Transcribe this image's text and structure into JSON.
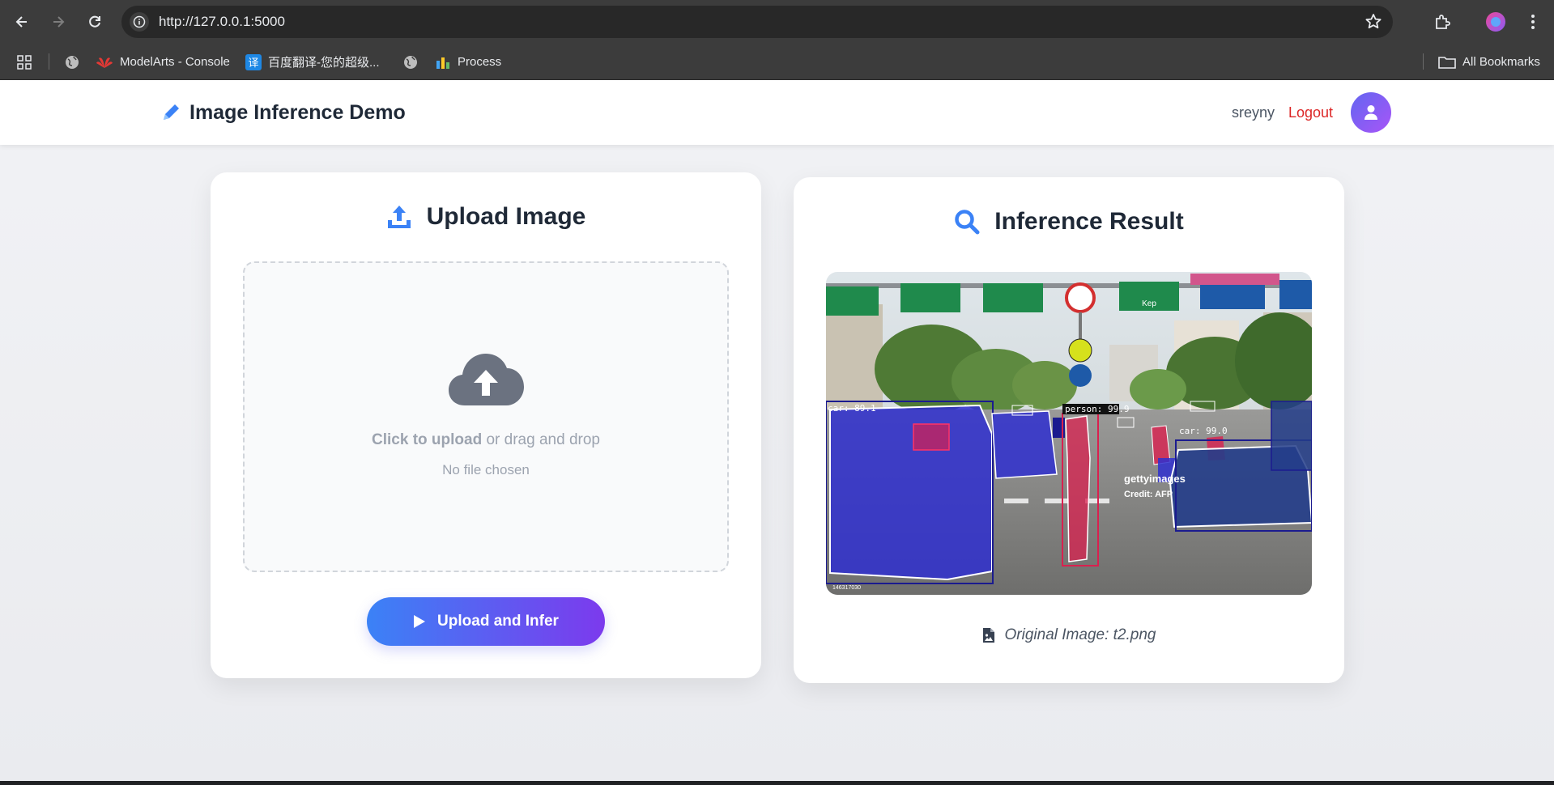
{
  "browser": {
    "url": "http://127.0.0.1:5000",
    "bookmarks": [
      {
        "label": "ModelArts - Console",
        "icon": "huawei-icon"
      },
      {
        "label": "百度翻译-您的超级...",
        "icon": "translate-icon"
      },
      {
        "label": "Process",
        "icon": "process-icon"
      }
    ],
    "all_bookmarks_label": "All Bookmarks"
  },
  "header": {
    "title": "Image Inference Demo",
    "username": "sreyny",
    "logout_label": "Logout",
    "accent_color": "#3b82f6"
  },
  "upload": {
    "title": "Upload Image",
    "click_text": "Click to upload",
    "drag_text": " or drag and drop",
    "file_status": "No file chosen",
    "button_label": "Upload and Infer"
  },
  "result": {
    "title": "Inference Result",
    "caption": "Original Image: t2.png",
    "detections": [
      {
        "label": "car: 89.1"
      },
      {
        "label": "person: 99.9"
      },
      {
        "label": "car: 99.0"
      }
    ],
    "watermark_brand": "gettyimages",
    "watermark_credit": "Credit: AFP",
    "image_id": "146317030",
    "sign_text": "Kep"
  }
}
